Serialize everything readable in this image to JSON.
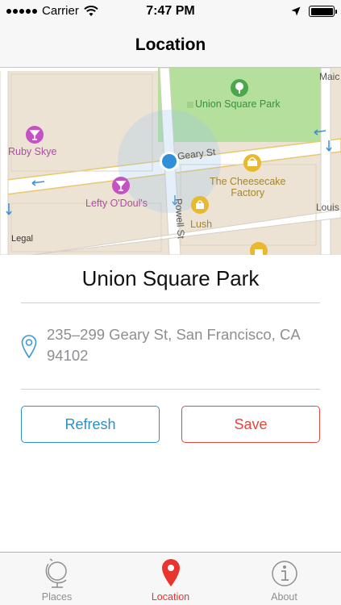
{
  "status_bar": {
    "carrier": "Carrier",
    "time": "7:47 PM"
  },
  "nav": {
    "title": "Location"
  },
  "map": {
    "labels": {
      "union_square_park": "Union Square Park",
      "ruby_skye": "Ruby Skye",
      "lefty_odouls": "Lefty O'Doul's",
      "cheesecake_factory": "The Cheesecake\nFactory",
      "lush": "Lush",
      "geary_st": "Geary St",
      "powell_st": "Powell St",
      "maiden": "Maic",
      "louis": "Louis",
      "legal": "Legal"
    }
  },
  "place": {
    "name": "Union Square Park",
    "address": "235–299 Geary St, San Francisco, CA 94102"
  },
  "buttons": {
    "refresh": "Refresh",
    "save": "Save"
  },
  "colors": {
    "accent_blue": "#2d8fc6",
    "accent_red": "#e0483e"
  },
  "tabs": [
    {
      "label": "Places",
      "icon": "globe-icon",
      "active": false
    },
    {
      "label": "Location",
      "icon": "map-pin-icon",
      "active": true
    },
    {
      "label": "About",
      "icon": "info-icon",
      "active": false
    }
  ]
}
